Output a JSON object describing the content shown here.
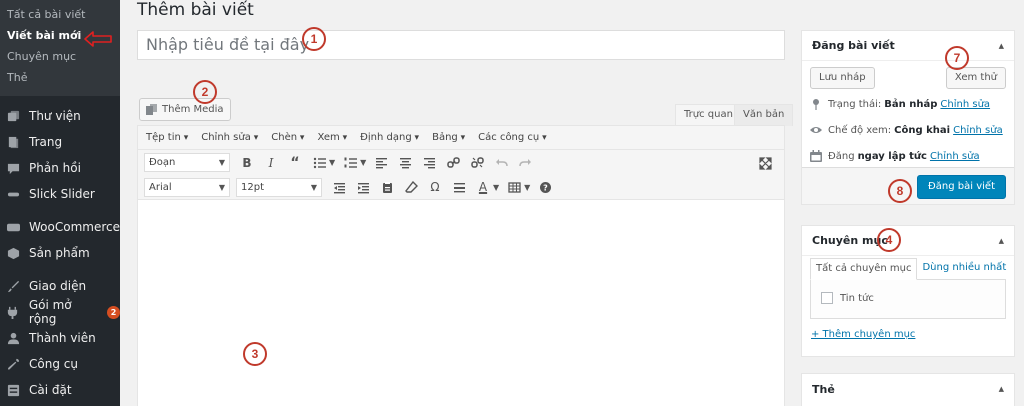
{
  "sidebar": {
    "submenu": [
      "Tất cả bài viết",
      "Viết bài mới",
      "Chuyên mục",
      "Thẻ"
    ],
    "menu_group1": [
      {
        "label": "Thư viện",
        "icon": "media-library-icon"
      },
      {
        "label": "Trang",
        "icon": "pages-icon"
      },
      {
        "label": "Phản hồi",
        "icon": "comments-icon"
      },
      {
        "label": "Slick Slider",
        "icon": "slider-icon"
      }
    ],
    "menu_group2": [
      {
        "label": "WooCommerce",
        "icon": "woocommerce-icon"
      },
      {
        "label": "Sản phẩm",
        "icon": "products-icon"
      }
    ],
    "menu_group3": [
      {
        "label": "Giao diện",
        "icon": "appearance-icon"
      },
      {
        "label": "Gói mở rộng",
        "icon": "plugins-icon",
        "badge": "2"
      },
      {
        "label": "Thành viên",
        "icon": "users-icon"
      },
      {
        "label": "Công cụ",
        "icon": "tools-icon"
      },
      {
        "label": "Cài đặt",
        "icon": "settings-icon"
      }
    ]
  },
  "main": {
    "page_title": "Thêm bài viết",
    "title_placeholder": "Nhập tiêu đề tại đây",
    "add_media_label": "Thêm Media",
    "tabs": {
      "visual": "Trực quan",
      "text": "Văn bản"
    },
    "menubar": [
      "Tệp tin",
      "Chỉnh sửa",
      "Chèn",
      "Xem",
      "Định dạng",
      "Bảng",
      "Các công cụ"
    ],
    "format_select": "Đoạn",
    "font_family_select": "Arial",
    "font_size_select": "12pt"
  },
  "publish_box": {
    "title": "Đăng bài viết",
    "save_draft": "Lưu nháp",
    "preview": "Xem thử",
    "status_label": "Trạng thái:",
    "status_value": "Bản nháp",
    "visibility_label": "Chế độ xem:",
    "visibility_value": "Công khai",
    "schedule_label": "Đăng",
    "schedule_value": "ngay lập tức",
    "edit_link": "Chỉnh sửa",
    "publish_button": "Đăng bài viết"
  },
  "category_box": {
    "title": "Chuyên mục",
    "tab_all": "Tất cả chuyên mục",
    "tab_popular": "Dùng nhiều nhất",
    "items": [
      "Tin tức"
    ],
    "add_link": "+ Thêm chuyên mục"
  },
  "tags_box": {
    "title": "Thẻ"
  },
  "annotations": [
    "1",
    "2",
    "3",
    "4",
    "7",
    "8"
  ],
  "colors": {
    "sidebar_bg": "#23282d",
    "submenu_bg": "#32373c",
    "accent_blue": "#0085ba",
    "annotation_red": "#c0392b",
    "badge": "#d54e21"
  }
}
